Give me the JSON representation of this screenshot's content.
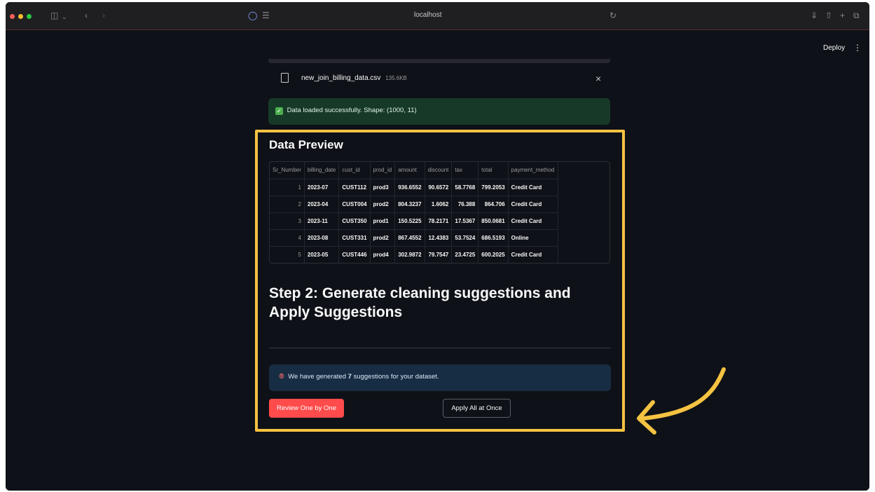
{
  "browser": {
    "url": "localhost"
  },
  "header": {
    "deploy_label": "Deploy",
    "menu_label": "⋮"
  },
  "uploader": {
    "file_name": "new_join_billing_data.csv",
    "file_size": "135.6KB",
    "close_label": "×"
  },
  "success_message": "Data loaded successfully. Shape: (1000, 11)",
  "preview": {
    "title": "Data Preview",
    "columns": [
      "Sr_Number",
      "billing_date",
      "cust_id",
      "prod_id",
      "amount",
      "discount",
      "tax",
      "total",
      "payment_method"
    ],
    "rows": [
      [
        "1",
        "2023-07",
        "CUST112",
        "prod3",
        "936.6552",
        "90.6572",
        "58.7768",
        "799.2053",
        "Credit Card"
      ],
      [
        "2",
        "2023-04",
        "CUST004",
        "prod2",
        "804.3237",
        "1.6062",
        "76.388",
        "864.706",
        "Credit Card"
      ],
      [
        "3",
        "2023-11",
        "CUST350",
        "prod1",
        "150.5225",
        "78.2171",
        "17.5367",
        "850.0681",
        "Credit Card"
      ],
      [
        "4",
        "2023-08",
        "CUST331",
        "prod2",
        "867.4552",
        "12.4383",
        "53.7524",
        "686.5193",
        "Online"
      ],
      [
        "5",
        "2023-05",
        "CUST446",
        "prod4",
        "302.9872",
        "79.7547",
        "23.4725",
        "600.2025",
        "Credit Card"
      ]
    ]
  },
  "step2": {
    "title": "Step 2: Generate cleaning suggestions and Apply Suggestions",
    "info_prefix": "We have generated ",
    "info_count": "7",
    "info_suffix": " suggestions for your dataset.",
    "review_button": "Review One by One",
    "apply_button": "Apply All at Once"
  },
  "colors": {
    "highlight": "#f5c342",
    "primary_button": "#ff4b4b",
    "success_bg": "#173928",
    "info_bg": "#172d43",
    "background": "#0e1117"
  }
}
